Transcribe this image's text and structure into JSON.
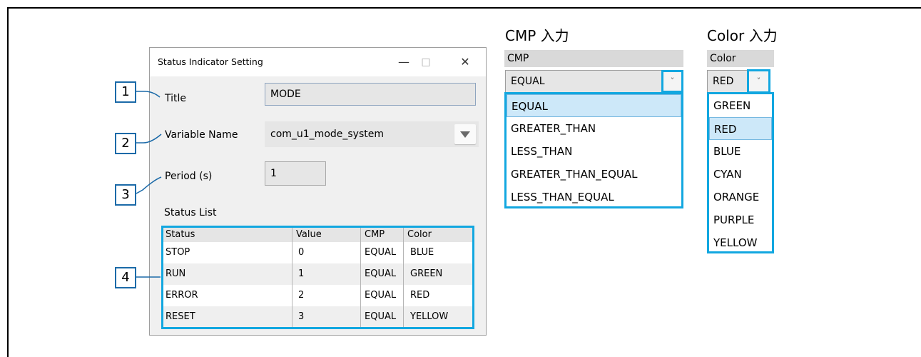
{
  "dialog": {
    "title": "Status Indicator Setting",
    "minimize_glyph": "—",
    "maximize_glyph": "□",
    "close_glyph": "✕",
    "title_label": "Title",
    "title_value": "MODE",
    "variable_label": "Variable Name",
    "variable_value": "com_u1_mode_system",
    "period_label": "Period (s)",
    "period_value": "1",
    "status_list_label": "Status List"
  },
  "status_table": {
    "columns": [
      "Status",
      "Value",
      "CMP",
      "Color"
    ],
    "rows": [
      {
        "status": "STOP",
        "value": "0",
        "cmp": "EQUAL",
        "color": "BLUE"
      },
      {
        "status": "RUN",
        "value": "1",
        "cmp": "EQUAL",
        "color": "GREEN"
      },
      {
        "status": "ERROR",
        "value": "2",
        "cmp": "EQUAL",
        "color": "RED"
      },
      {
        "status": "RESET",
        "value": "3",
        "cmp": "EQUAL",
        "color": "YELLOW"
      }
    ]
  },
  "callouts": [
    "1",
    "2",
    "3",
    "4"
  ],
  "cmp_panel": {
    "heading": "CMP 入力",
    "header": "CMP",
    "selected": "EQUAL",
    "arrow_glyph": "˅",
    "options": [
      "EQUAL",
      "GREATER_THAN",
      "LESS_THAN",
      "GREATER_THAN_EQUAL",
      "LESS_THAN_EQUAL"
    ],
    "highlighted_index": 0
  },
  "color_panel": {
    "heading": "Color 入力",
    "header": "Color",
    "selected": "RED",
    "arrow_glyph": "˅",
    "options": [
      "GREEN",
      "RED",
      "BLUE",
      "CYAN",
      "ORANGE",
      "PURPLE",
      "YELLOW"
    ],
    "highlighted_index": 1
  },
  "colors": {
    "highlight_border": "#12a7e0",
    "callout_border": "#1b6aa8",
    "selected_item": "#cde8f9"
  }
}
